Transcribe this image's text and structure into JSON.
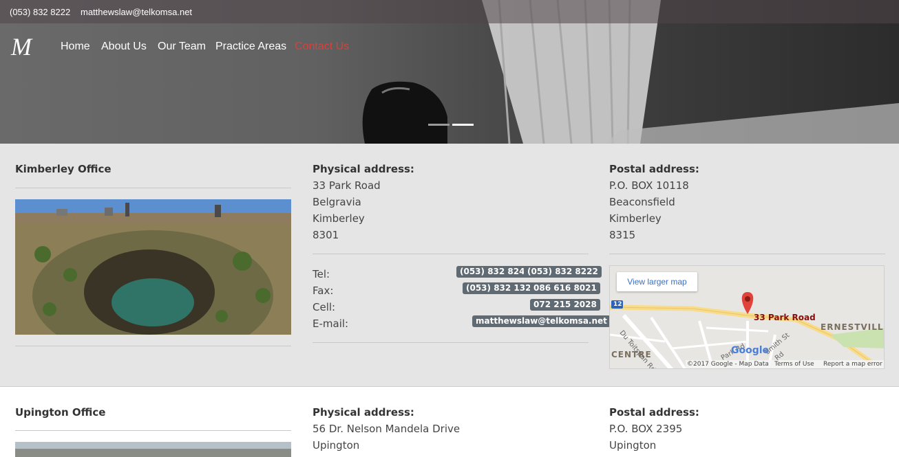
{
  "topbar": {
    "phone": "(053) 832 8222",
    "email": "matthewslaw@telkomsa.net"
  },
  "logo": {
    "letter": "M"
  },
  "nav": {
    "items": [
      {
        "label": "Home"
      },
      {
        "label": "About Us"
      },
      {
        "label": "Our Team"
      },
      {
        "label": "Practice Areas"
      },
      {
        "label": "Contact Us",
        "active": true
      }
    ]
  },
  "slider": {
    "dots": 2,
    "active": 2
  },
  "colors": {
    "accent": "#d9403a",
    "badge": "#606a73",
    "office_bg": "#e5e5e5"
  },
  "offices": [
    {
      "name": "Kimberley Office",
      "physical_heading": "Physical address:",
      "physical": [
        "33 Park Road",
        "Belgravia",
        "Kimberley",
        "8301"
      ],
      "postal_heading": "Postal address:",
      "postal": [
        "P.O. BOX 10118",
        "Beaconsfield",
        "Kimberley",
        "8315"
      ],
      "contacts": {
        "tel_label": "Tel:",
        "tel": [
          "(053) 832 8247",
          "(053) 832 8222"
        ],
        "fax_label": "Fax:",
        "fax": [
          "(053) 832 1324",
          "086 616 8021"
        ],
        "cell_label": "Cell:",
        "cell": "072 215 2028",
        "email_label": "E-mail:",
        "email": "matthewslaw@telkomsa.net"
      },
      "map": {
        "view_larger": "View larger map",
        "marker_label": "33 Park Road",
        "area_east": "ERNESTVILLE",
        "area_centre": "CENTRE",
        "road_badge": "12",
        "roads": [
          "Du Toitspan Rd",
          "Park Rd",
          "Smith St",
          "Rd"
        ],
        "logo": "Google",
        "copyright": "©2017 Google - Map Data",
        "terms": "Terms of Use",
        "report": "Report a map error"
      }
    },
    {
      "name": "Upington Office",
      "physical_heading": "Physical address:",
      "physical": [
        "56 Dr. Nelson Mandela Drive",
        "Upington"
      ],
      "postal_heading": "Postal address:",
      "postal": [
        "P.O. BOX 2395",
        "Upington"
      ]
    }
  ]
}
